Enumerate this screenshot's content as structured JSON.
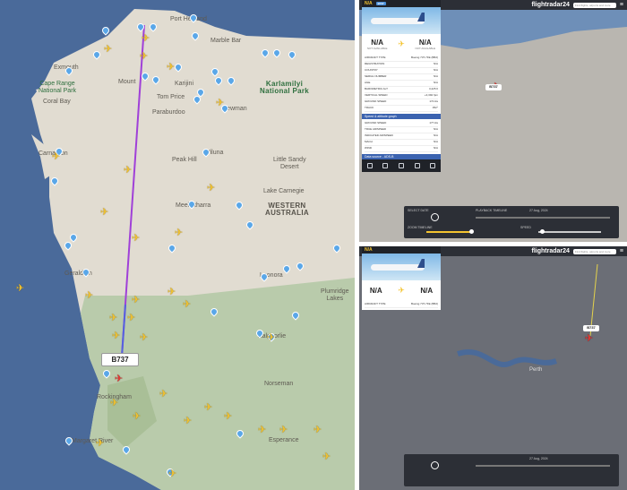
{
  "left_map": {
    "flight_label": "B737",
    "labels": {
      "port_hedland": "Port Hedland",
      "marble_bar": "Marble Bar",
      "exmouth": "Exmouth",
      "cape_range": "Cape Range\nNational Park",
      "coral_bay": "Coral Bay",
      "karlamilyi": "Karlamilyi\nNational Park",
      "mount_tom_price": "Mount",
      "karijini": "Karijini",
      "tom_price": "Tom Price",
      "paraburdoo": "Paraburdoo",
      "newman": "Newman",
      "carnarvon": "Carnarvon",
      "peak_hill": "Peak Hill",
      "wiluna": "Wiluna",
      "little_sandy": "Little Sandy\nDesert",
      "lake_carnegie": "Lake Carnegie",
      "meekatharra": "Meekatharra",
      "western_australia": "WESTERN\nAUSTRALIA",
      "geraldton": "Geraldton",
      "leonora": "Leonora",
      "plumridge": "Plumridge\nLakes",
      "kalgoorlie": "Kalgoorlie",
      "norseman": "Norseman",
      "rockingham": "Rockingham",
      "margaret_river": "Margaret River",
      "esperance": "Esperance",
      "perth_area": "Perth"
    }
  },
  "right_top": {
    "app": {
      "logo": "flightradar24",
      "search_placeholder": "Find flights, airports and more"
    },
    "card": {
      "callsign": "N/A",
      "badge": "B737",
      "origin": "N/A",
      "origin_sub": "NOT AVAILABLE",
      "destination": "N/A",
      "destination_sub": "NOT AVAILABLE",
      "aircraft_label": "AIRCRAFT TYPE",
      "aircraft": "Boeing 737-7FE (BBJ)",
      "rows": [
        [
          "REGISTRATION",
          "N/A"
        ],
        [
          "COUNTRY",
          "N/A"
        ],
        [
          "SERIAL NUMBER",
          "N/A"
        ],
        [
          "AGE",
          "N/A"
        ],
        [
          "BAROMETRIC ALT",
          "3,225 ft"
        ],
        [
          "VERTICAL SPEED",
          "+3,392 fpm"
        ],
        [
          "GROUND SPEED",
          "172 kts"
        ],
        [
          "TRACK",
          "352°"
        ]
      ],
      "section_speed": "Speed & altitude graph",
      "rows2": [
        [
          "GROUND SPEED",
          "177 kts"
        ],
        [
          "TRUE AIRSPEED",
          "N/A"
        ],
        [
          "INDICATED AIRSPEED",
          "N/A"
        ],
        [
          "MACH",
          "N/A"
        ],
        [
          "WIND",
          "N/A"
        ],
        [
          "TEMPERATURE",
          "N/A"
        ],
        [
          "FIR/UIR",
          "N/A"
        ]
      ],
      "section_data": "Data source - ADS-B",
      "toolbar": [
        "3D view",
        "Route",
        "Follow",
        "Share",
        "More"
      ]
    },
    "map": {
      "flight_label": "B737"
    },
    "playback": {
      "select_date": "SELECT DATE",
      "playback_timeline": "PLAYBACK TIMELINE",
      "date_value": "27 Aug, 2024",
      "zoom_label": "ZOOM TIMELINE",
      "speed_label": "SPEED"
    }
  },
  "right_bottom": {
    "card": {
      "callsign": "N/A",
      "origin": "N/A",
      "destination": "N/A",
      "aircraft": "Boeing 737-7FE (BBJ)"
    },
    "map": {
      "city": "Perth",
      "flight_label": "B737"
    },
    "playback": {
      "date_value": "27 Aug, 2024"
    }
  }
}
